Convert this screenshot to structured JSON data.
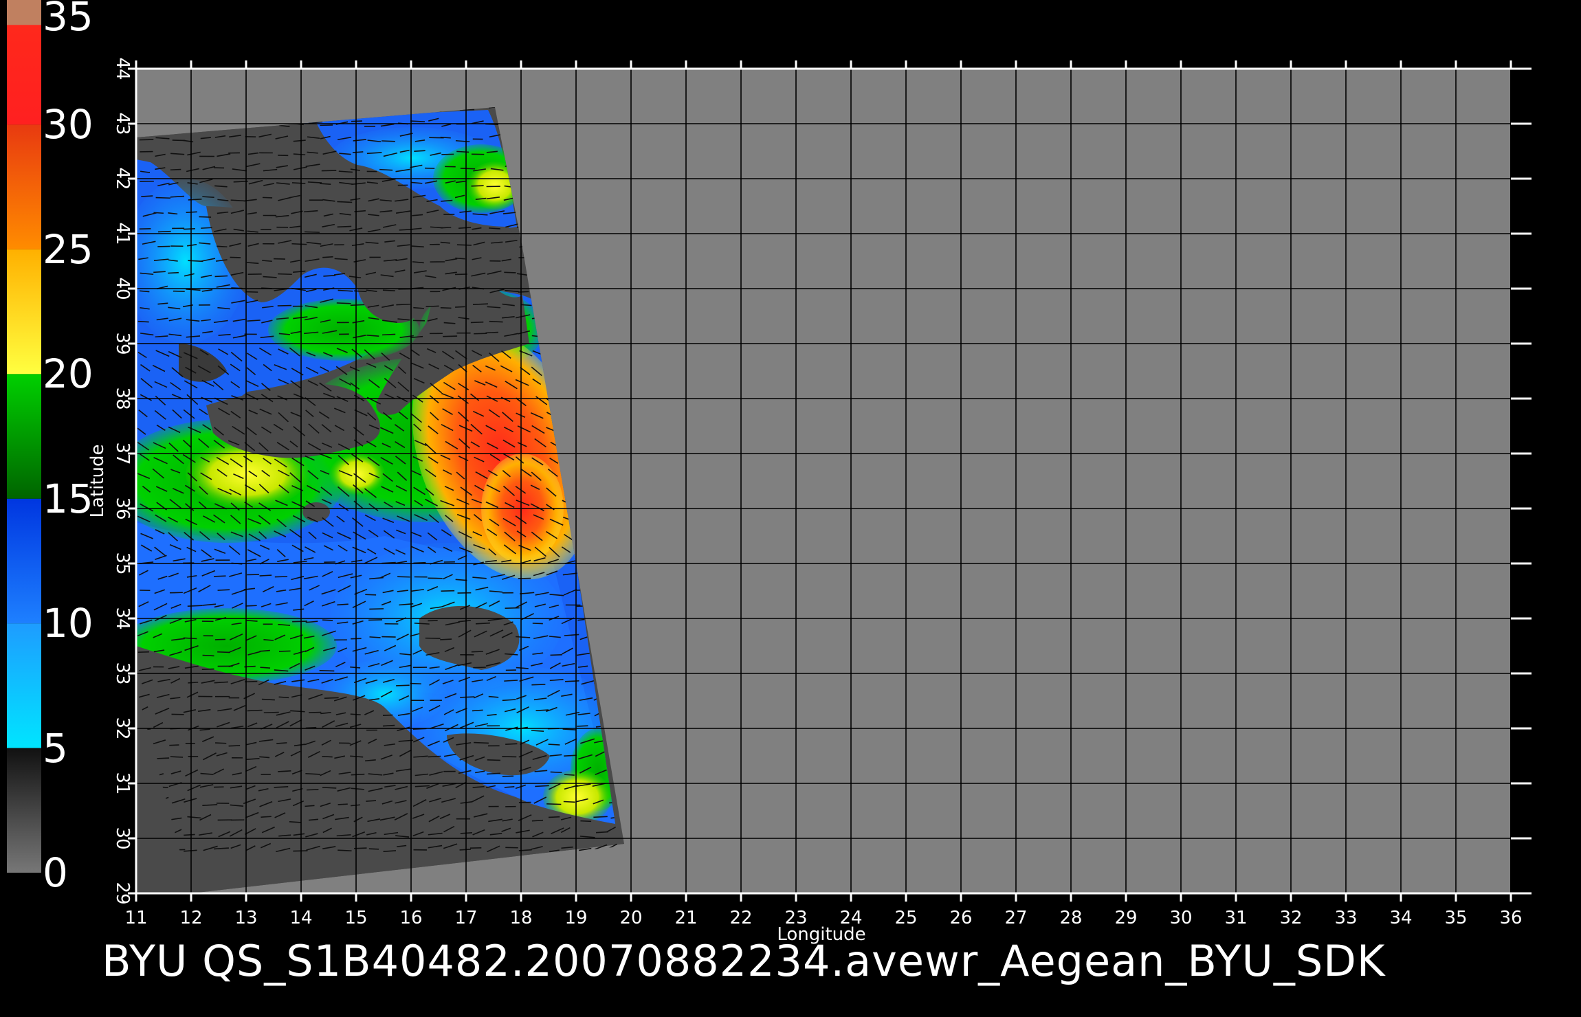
{
  "caption": "BYU  QS_S1B40482.20070882234.avewr_Aegean_BYU_SDK",
  "axes": {
    "xlabel": "Longitude",
    "ylabel": "Latitude",
    "x_ticks": [
      11,
      12,
      13,
      14,
      15,
      16,
      17,
      18,
      19,
      20,
      21,
      22,
      23,
      24,
      25,
      26,
      27,
      28,
      29,
      30,
      31,
      32,
      33,
      34,
      35,
      36
    ],
    "y_ticks": [
      29,
      30,
      31,
      32,
      33,
      34,
      35,
      36,
      37,
      38,
      39,
      40,
      41,
      42,
      43,
      44
    ],
    "xlim": [
      11,
      36
    ],
    "ylim": [
      29,
      44
    ]
  },
  "colorbar": {
    "ticks": [
      "0",
      "5",
      "10",
      "15",
      "20",
      "25",
      "30",
      "35"
    ],
    "range": [
      0,
      35
    ],
    "segments": [
      {
        "from": 0,
        "to": 5,
        "colors": [
          "#777777",
          "#444444",
          "#111111"
        ]
      },
      {
        "from": 5,
        "to": 10,
        "colors": [
          "#00e5ff",
          "#1e9cff"
        ]
      },
      {
        "from": 10,
        "to": 15,
        "colors": [
          "#1e80ff",
          "#0036e0"
        ]
      },
      {
        "from": 15,
        "to": 20,
        "colors": [
          "#006400",
          "#00d000"
        ]
      },
      {
        "from": 20,
        "to": 25,
        "colors": [
          "#ffff40",
          "#ffb000"
        ]
      },
      {
        "from": 25,
        "to": 30,
        "colors": [
          "#ff8c00",
          "#e83a10"
        ]
      },
      {
        "from": 30,
        "to": 35,
        "colors": [
          "#ff2020",
          "#ff2a1a"
        ]
      },
      {
        "from": 34,
        "to": 35,
        "colors": [
          "#c08060",
          "#c08060"
        ]
      }
    ]
  },
  "colors": {
    "background": "#000000",
    "plot_fill": "#808080",
    "swath_nodata": "#4a4a4a",
    "grid": "#000000",
    "text": "#ffffff"
  }
}
